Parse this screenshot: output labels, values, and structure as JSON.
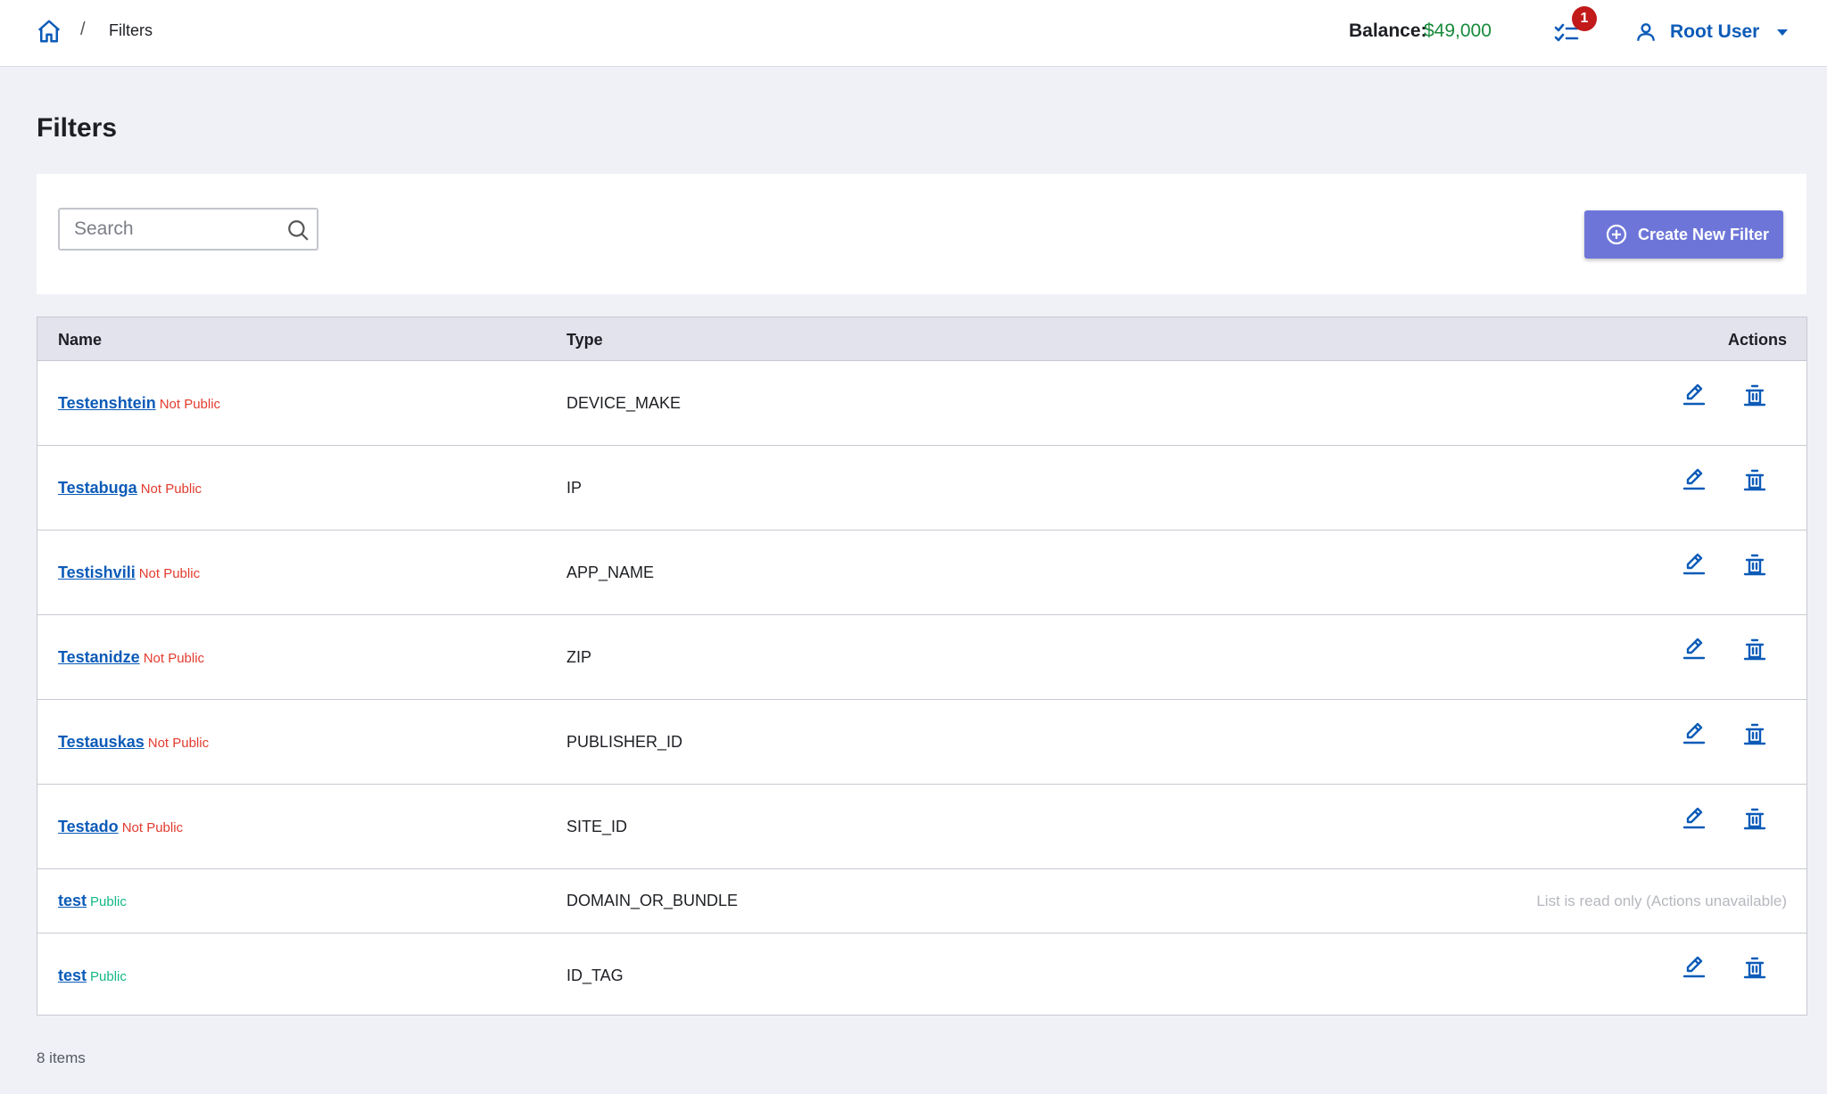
{
  "breadcrumb": {
    "separator": "/",
    "current": "Filters"
  },
  "header": {
    "balance_label": "Balance:",
    "balance_value": "$49,000",
    "tasks_badge": "1",
    "user_name": "Root User"
  },
  "page": {
    "title": "Filters"
  },
  "search": {
    "placeholder": "Search",
    "value": ""
  },
  "toolbar": {
    "create_label": "Create New Filter"
  },
  "table": {
    "columns": {
      "name": "Name",
      "type": "Type",
      "actions": "Actions"
    },
    "rows": [
      {
        "name": "Testenshtein",
        "visibility": "Not Public",
        "type": "DEVICE_MAKE"
      },
      {
        "name": "Testabuga",
        "visibility": "Not Public",
        "type": "IP"
      },
      {
        "name": "Testishvili",
        "visibility": "Not Public",
        "type": "APP_NAME"
      },
      {
        "name": "Testanidze",
        "visibility": "Not Public",
        "type": "ZIP"
      },
      {
        "name": "Testauskas",
        "visibility": "Not Public",
        "type": "PUBLISHER_ID"
      },
      {
        "name": "Testado",
        "visibility": "Not Public",
        "type": "SITE_ID"
      },
      {
        "name": "test",
        "visibility": "Public",
        "type": "DOMAIN_OR_BUNDLE",
        "readonly_text": "List is read only (Actions unavailable)"
      },
      {
        "name": "test",
        "visibility": "Public",
        "type": "ID_TAG"
      }
    ]
  },
  "footer": {
    "count": "8 items"
  },
  "colors": {
    "accent": "#0c5bb8",
    "button": "#6d76d8",
    "balance": "#178a3a",
    "not_public": "#e23b2e",
    "public": "#12b886",
    "badge": "#c21a1a"
  },
  "icons": [
    "home-icon",
    "tasks-icon",
    "user-icon",
    "search-icon",
    "plus-circle-icon",
    "edit-icon",
    "delete-icon"
  ]
}
